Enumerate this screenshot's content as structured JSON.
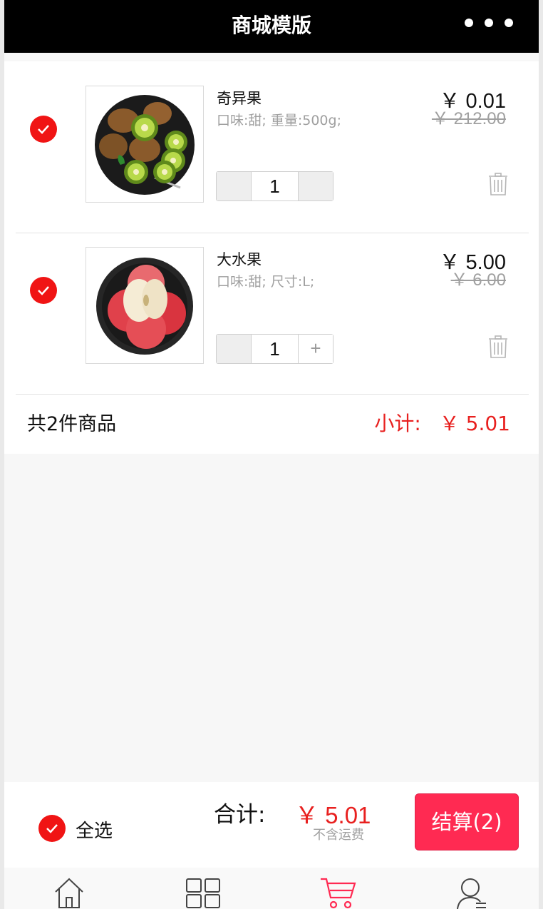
{
  "header": {
    "title": "商城模版",
    "more_icon": "more-dots-icon"
  },
  "cart": {
    "items": [
      {
        "name": "奇异果",
        "spec": "口味:甜; 重量:500g;",
        "price": "￥ 0.01",
        "original_price": "￥ 212.00",
        "quantity": "1",
        "checked": true,
        "image": "kiwi-fruit-plate"
      },
      {
        "name": "大水果",
        "spec": "口味:甜; 尺寸:L;",
        "price": "￥ 5.00",
        "original_price": "￥ 6.00",
        "quantity": "1",
        "checked": true,
        "image": "apple-fruit-plate",
        "plus_label": "+"
      }
    ],
    "summary": {
      "count_text": "共2件商品",
      "subtotal_label": "小计:",
      "subtotal_amount": "￥ 5.01"
    }
  },
  "checkout": {
    "select_all_label": "全选",
    "total_label": "合计:",
    "total_amount": "￥ 5.01",
    "shipping_note": "不含运费",
    "pay_button_label": "结算(2)"
  },
  "tabbar": {
    "tabs": [
      {
        "icon": "home-icon",
        "active": false
      },
      {
        "icon": "category-grid-icon",
        "active": false
      },
      {
        "icon": "cart-icon",
        "active": true
      },
      {
        "icon": "user-profile-icon",
        "active": false
      }
    ]
  },
  "colors": {
    "accent": "#e8201f",
    "pay_button": "#ff2a52",
    "check": "#f01414",
    "header_bg": "#000000"
  }
}
